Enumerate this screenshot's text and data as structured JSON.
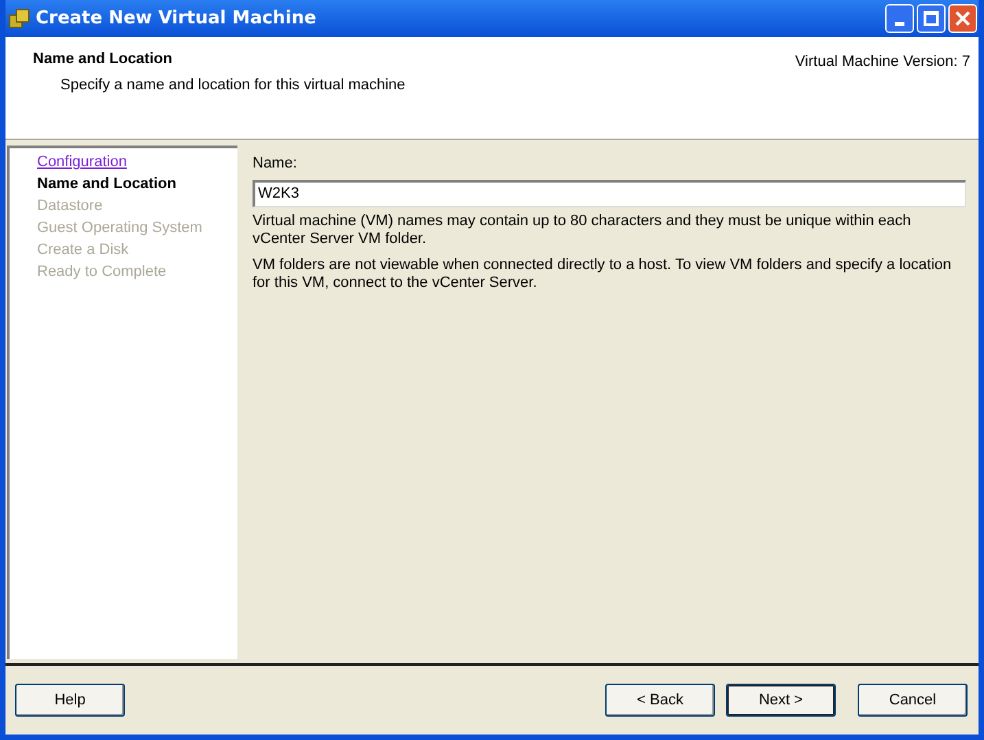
{
  "window": {
    "title": "Create New Virtual Machine"
  },
  "header": {
    "title": "Name and Location",
    "subtitle": "Specify a name and location for this virtual machine",
    "version": "Virtual Machine Version: 7"
  },
  "steps": [
    {
      "label": "Configuration",
      "selected": false,
      "disabled": false
    },
    {
      "label": "Name and Location",
      "selected": true,
      "disabled": false
    },
    {
      "label": "Datastore",
      "selected": false,
      "disabled": true
    },
    {
      "label": "Guest Operating System",
      "selected": false,
      "disabled": true
    },
    {
      "label": "Create a Disk",
      "selected": false,
      "disabled": true
    },
    {
      "label": "Ready to Complete",
      "selected": false,
      "disabled": true
    }
  ],
  "form": {
    "name_label": "Name:",
    "name_value": "W2K3",
    "notes": [
      "Virtual machine (VM) names may contain up to 80 characters and they must be unique within each vCenter Server VM folder.",
      "VM folders are not viewable when connected directly to a host. To view VM folders and specify a location for this VM, connect to the vCenter Server."
    ]
  },
  "buttons": [
    {
      "label": "Help",
      "default": false
    },
    {
      "label": "< Back",
      "default": false
    },
    {
      "label": "Next >",
      "default": true
    },
    {
      "label": "Cancel",
      "default": false
    }
  ]
}
